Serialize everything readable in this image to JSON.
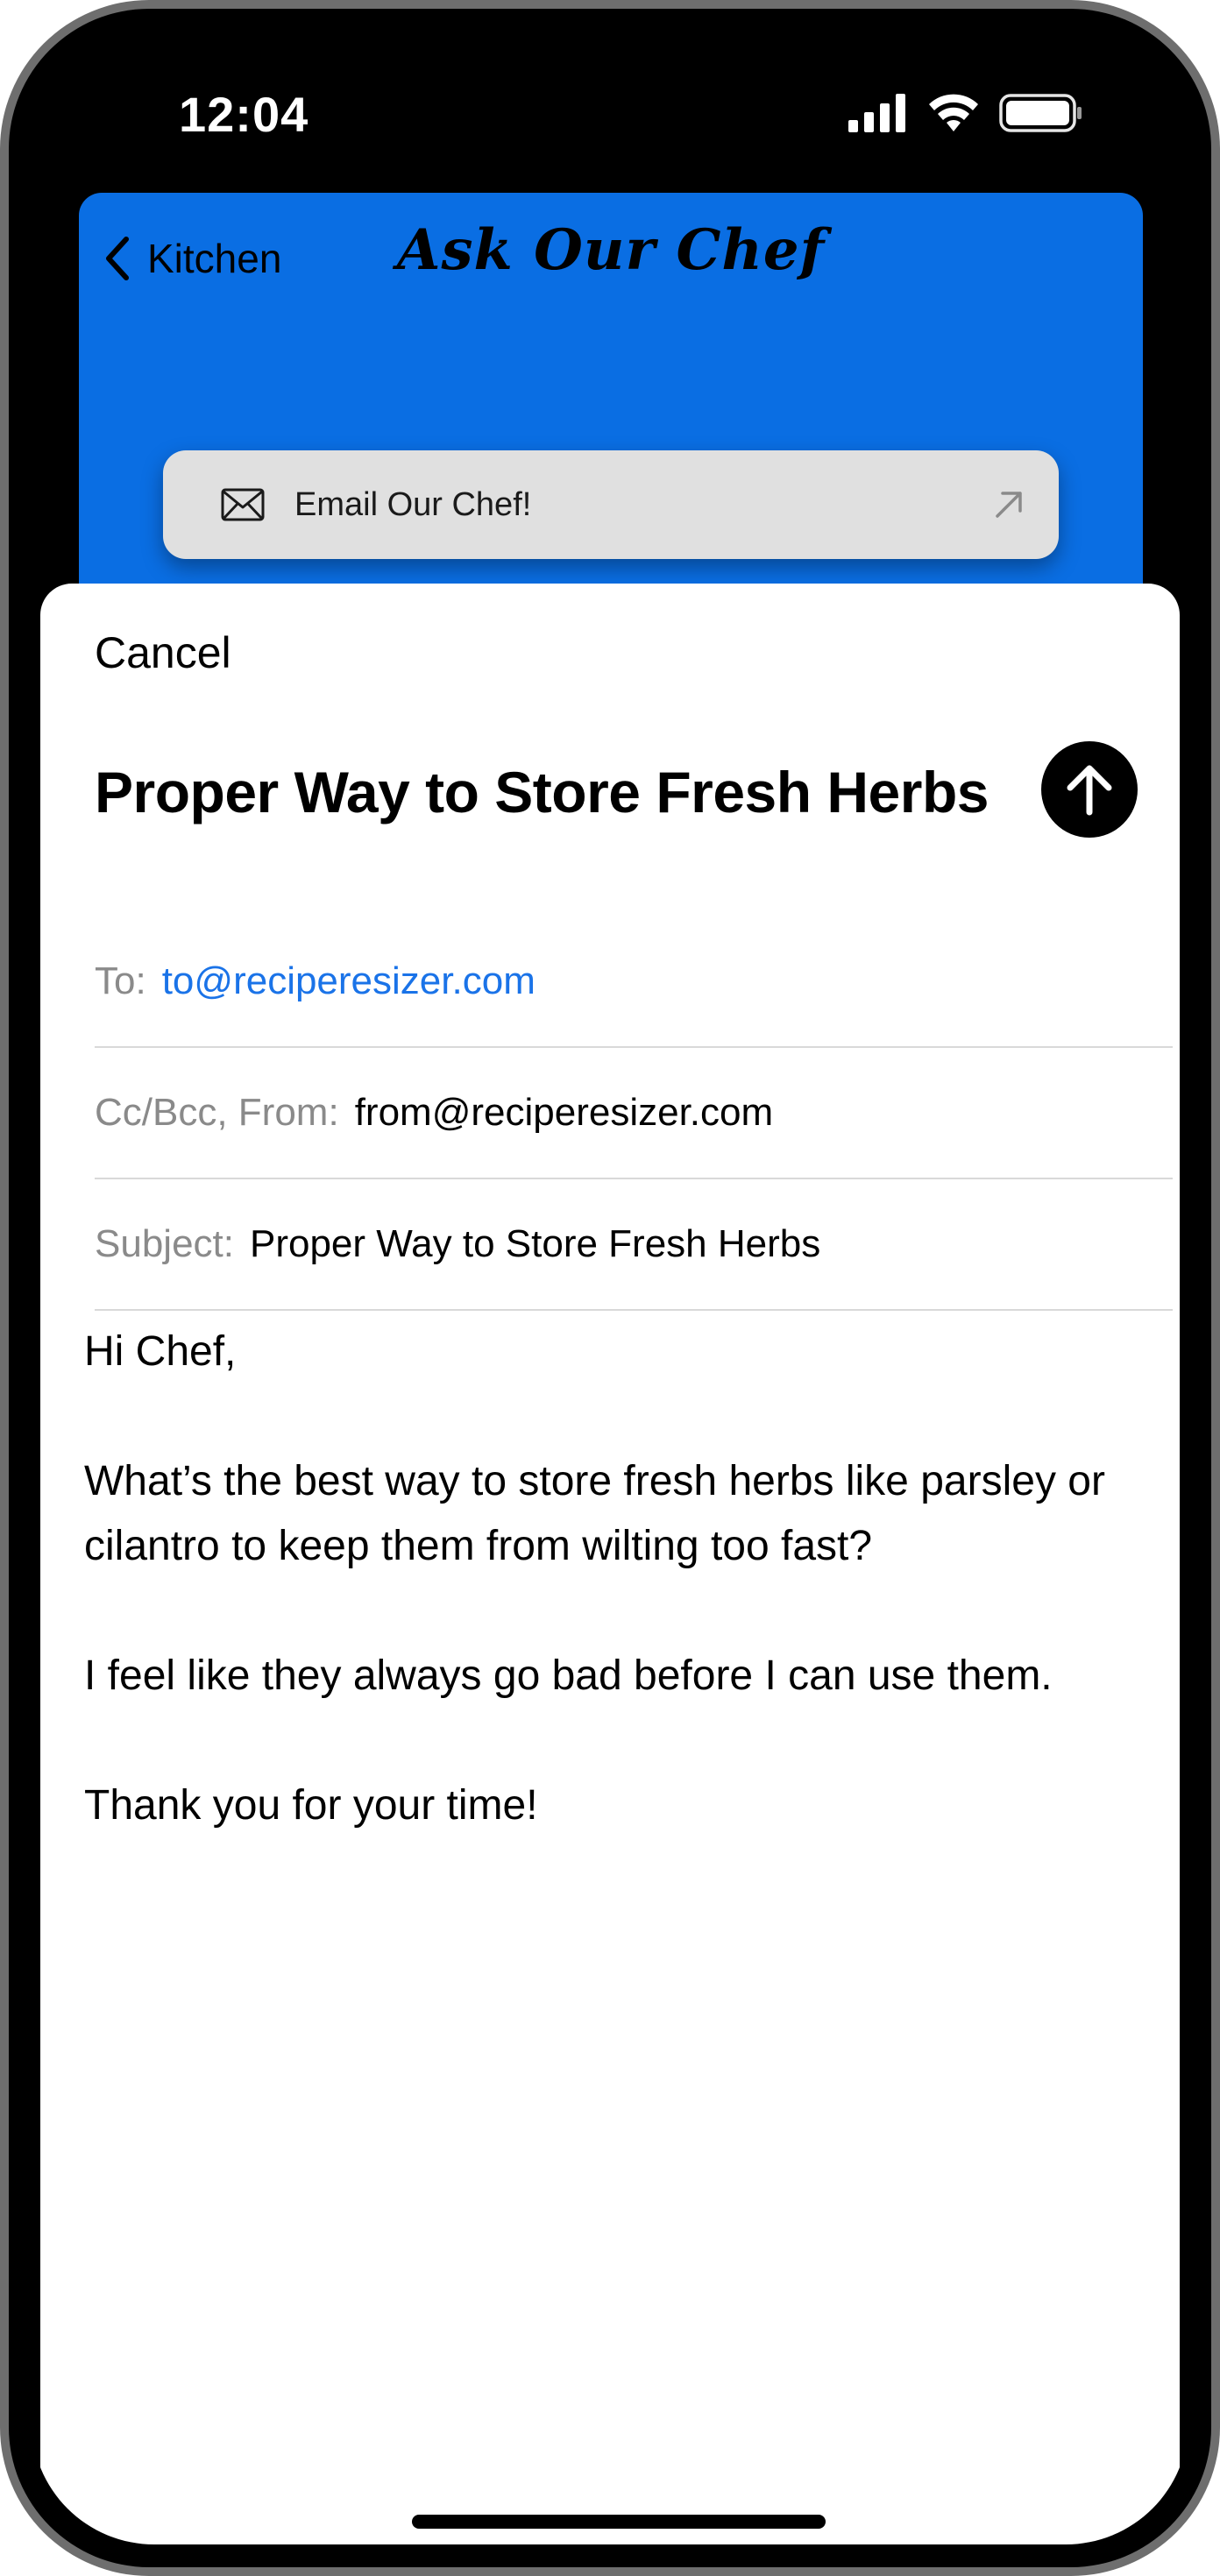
{
  "status_bar": {
    "time": "12:04"
  },
  "header": {
    "back_label": "Kitchen",
    "title": "Ask Our Chef",
    "accent_color": "#0a6ee3"
  },
  "email_button": {
    "label": "Email Our Chef!"
  },
  "compose": {
    "cancel_label": "Cancel",
    "title": "Proper Way to Store Fresh Herbs",
    "to_label": "To:",
    "to_value": "to@reciperesizer.com",
    "cc_label": "Cc/Bcc, From:",
    "cc_value": "from@reciperesizer.com",
    "subject_label": "Subject:",
    "subject_value": "Proper Way to Store Fresh Herbs",
    "body": [
      "Hi Chef,",
      "What’s the best way to store fresh herbs like parsley or cilantro to keep them from wilting too fast?",
      "I feel like they always go bad before I can use them.",
      "Thank you for your time!"
    ]
  },
  "icons": {
    "back": "chevron-left-icon",
    "envelope": "envelope-icon",
    "external": "arrow-up-right-icon",
    "send": "arrow-up-icon",
    "signal": "cellular-signal-icon",
    "wifi": "wifi-icon",
    "battery": "battery-icon"
  }
}
